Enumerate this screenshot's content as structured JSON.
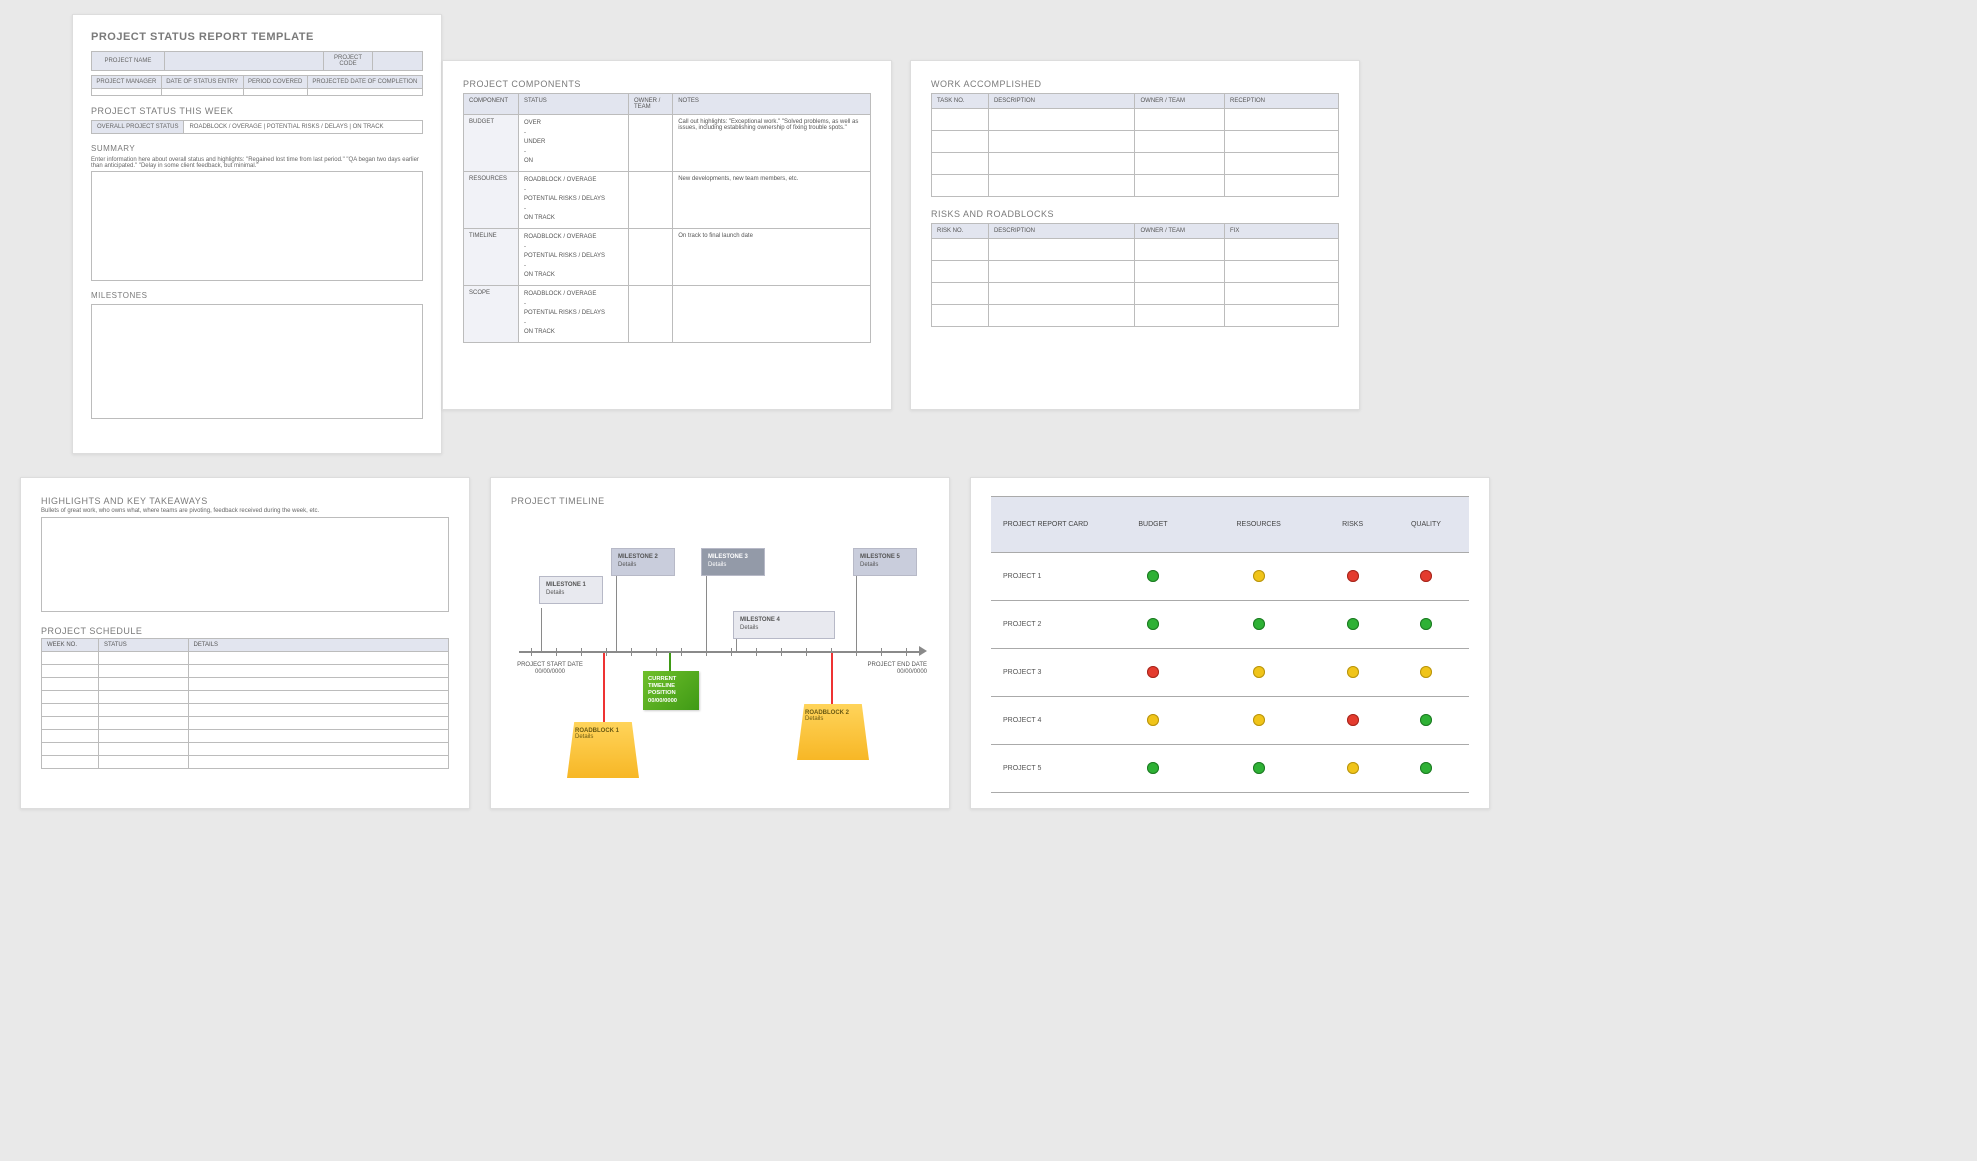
{
  "p1": {
    "title": "PROJECT STATUS REPORT TEMPLATE",
    "row1": {
      "c1": "PROJECT NAME",
      "c2": "PROJECT CODE"
    },
    "row2": {
      "c1": "PROJECT MANAGER",
      "c2": "DATE OF STATUS ENTRY",
      "c3": "PERIOD COVERED",
      "c4": "PROJECTED DATE OF COMPLETION"
    },
    "sec_week": "PROJECT STATUS THIS WEEK",
    "status_lead": "OVERALL PROJECT STATUS",
    "status_rest": "ROADBLOCK / OVERAGE    |    POTENTIAL RISKS / DELAYS    |    ON TRACK",
    "sec_summary": "SUMMARY",
    "summary_hint": "Enter information here about overall status and highlights: \"Regained lost time from last period.\" \"QA began two days earlier than anticipated.\" \"Delay in some client feedback, but minimal.\"",
    "sec_milestones": "MILESTONES"
  },
  "p2": {
    "sec": "PROJECT COMPONENTS",
    "headers": [
      "COMPONENT",
      "STATUS",
      "OWNER / TEAM",
      "NOTES"
    ],
    "rows": [
      {
        "label": "BUDGET",
        "status": "OVER\n-\nUNDER\n-\nON",
        "owner": "",
        "notes": "Call out highlights: \"Exceptional work.\" \"Solved problems, as well as issues, including establishing ownership of fixing trouble spots.\""
      },
      {
        "label": "RESOURCES",
        "status": "ROADBLOCK / OVERAGE\n-\nPOTENTIAL RISKS / DELAYS\n-\nON TRACK",
        "owner": "",
        "notes": "New developments, new team members, etc."
      },
      {
        "label": "TIMELINE",
        "status": "ROADBLOCK / OVERAGE\n-\nPOTENTIAL RISKS / DELAYS\n-\nON TRACK",
        "owner": "",
        "notes": "On track to final launch date"
      },
      {
        "label": "SCOPE",
        "status": "ROADBLOCK / OVERAGE\n-\nPOTENTIAL RISKS / DELAYS\n-\nON TRACK",
        "owner": "",
        "notes": ""
      }
    ]
  },
  "p3": {
    "sec1": "WORK ACCOMPLISHED",
    "headers1": [
      "TASK NO.",
      "DESCRIPTION",
      "OWNER / TEAM",
      "RECEPTION"
    ],
    "sec2": "RISKS AND ROADBLOCKS",
    "headers2": [
      "RISK NO.",
      "DESCRIPTION",
      "OWNER / TEAM",
      "FIX"
    ]
  },
  "p4": {
    "sec1": "HIGHLIGHTS AND KEY TAKEAWAYS",
    "hint": "Bullets of great work, who owns what, where teams are pivoting, feedback received during the week, etc.",
    "sec2": "PROJECT SCHEDULE",
    "headers": [
      "WEEK NO.",
      "STATUS",
      "DETAILS"
    ]
  },
  "p5": {
    "sec": "PROJECT TIMELINE",
    "start": {
      "l1": "PROJECT START DATE",
      "l2": "00/00/0000"
    },
    "end": {
      "l1": "PROJECT END DATE",
      "l2": "00/00/0000"
    },
    "ms": [
      {
        "t": "MILESTONE 1",
        "d": "Details"
      },
      {
        "t": "MILESTONE 2",
        "d": "Details"
      },
      {
        "t": "MILESTONE 3",
        "d": "Details"
      },
      {
        "t": "MILESTONE 4",
        "d": "Details"
      },
      {
        "t": "MILESTONE 5",
        "d": "Details"
      }
    ],
    "current": {
      "l1": "CURRENT",
      "l2": "TIMELINE",
      "l3": "POSITION",
      "l4": "00/00/0000"
    },
    "rb": [
      {
        "t": "ROADBLOCK 1",
        "d": "Details"
      },
      {
        "t": "ROADBLOCK 2",
        "d": "Details"
      }
    ]
  },
  "p6": {
    "corner": "PROJECT REPORT CARD",
    "headers": [
      "BUDGET",
      "RESOURCES",
      "RISKS",
      "QUALITY"
    ],
    "rows": [
      {
        "label": "PROJECT 1",
        "cells": [
          "g",
          "y",
          "r",
          "r"
        ]
      },
      {
        "label": "PROJECT 2",
        "cells": [
          "g",
          "g",
          "g",
          "g"
        ]
      },
      {
        "label": "PROJECT 3",
        "cells": [
          "r",
          "y",
          "y",
          "y"
        ]
      },
      {
        "label": "PROJECT 4",
        "cells": [
          "y",
          "y",
          "r",
          "g"
        ]
      },
      {
        "label": "PROJECT 5",
        "cells": [
          "g",
          "g",
          "y",
          "g"
        ]
      }
    ]
  }
}
